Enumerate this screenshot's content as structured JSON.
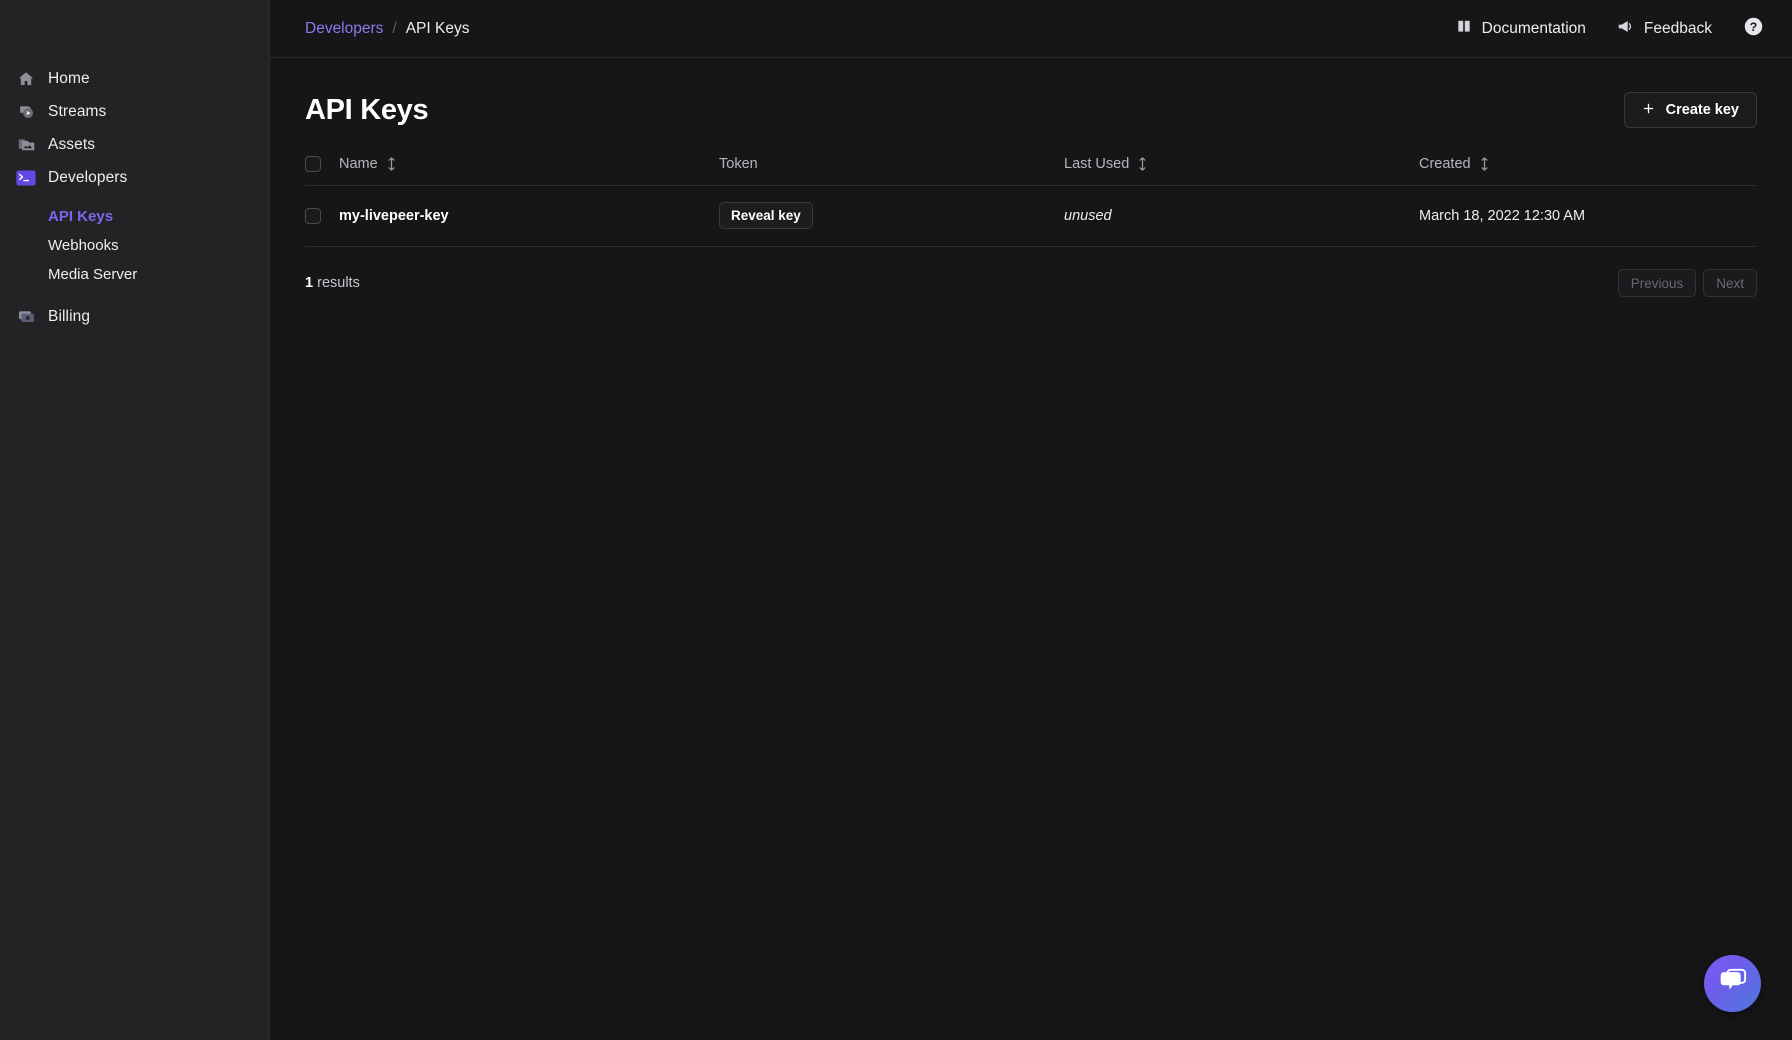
{
  "sidebar": {
    "items": [
      {
        "label": "Home",
        "icon": "home-icon"
      },
      {
        "label": "Streams",
        "icon": "streams-icon"
      },
      {
        "label": "Assets",
        "icon": "assets-icon"
      },
      {
        "label": "Developers",
        "icon": "terminal-icon"
      },
      {
        "label": "Billing",
        "icon": "billing-icon"
      }
    ],
    "subitems": [
      {
        "label": "API Keys",
        "active": true
      },
      {
        "label": "Webhooks",
        "active": false
      },
      {
        "label": "Media Server",
        "active": false
      }
    ],
    "active_color": "#7c66f0"
  },
  "topbar": {
    "breadcrumb": {
      "parent": "Developers",
      "separator": "/",
      "current": "API Keys"
    },
    "documentation_label": "Documentation",
    "documentation_icon": "book-icon",
    "feedback_label": "Feedback",
    "feedback_icon": "megaphone-icon",
    "help_icon": "help-circle-icon"
  },
  "page": {
    "title": "API Keys",
    "create_button_label": "Create key",
    "create_button_icon": "plus-icon"
  },
  "table": {
    "columns": [
      {
        "key": "check",
        "label": "",
        "sortable": false
      },
      {
        "key": "name",
        "label": "Name",
        "sortable": true
      },
      {
        "key": "token",
        "label": "Token",
        "sortable": false
      },
      {
        "key": "last_used",
        "label": "Last Used",
        "sortable": true
      },
      {
        "key": "created",
        "label": "Created",
        "sortable": true
      }
    ],
    "rows": [
      {
        "name": "my-livepeer-key",
        "token_button_label": "Reveal key",
        "last_used": "unused",
        "created": "March 18, 2022 12:30 AM",
        "selected": false
      }
    ]
  },
  "footer": {
    "results_count": "1",
    "results_label": "results",
    "previous_label": "Previous",
    "next_label": "Next"
  },
  "chat": {
    "icon": "chat-bubbles-icon"
  }
}
